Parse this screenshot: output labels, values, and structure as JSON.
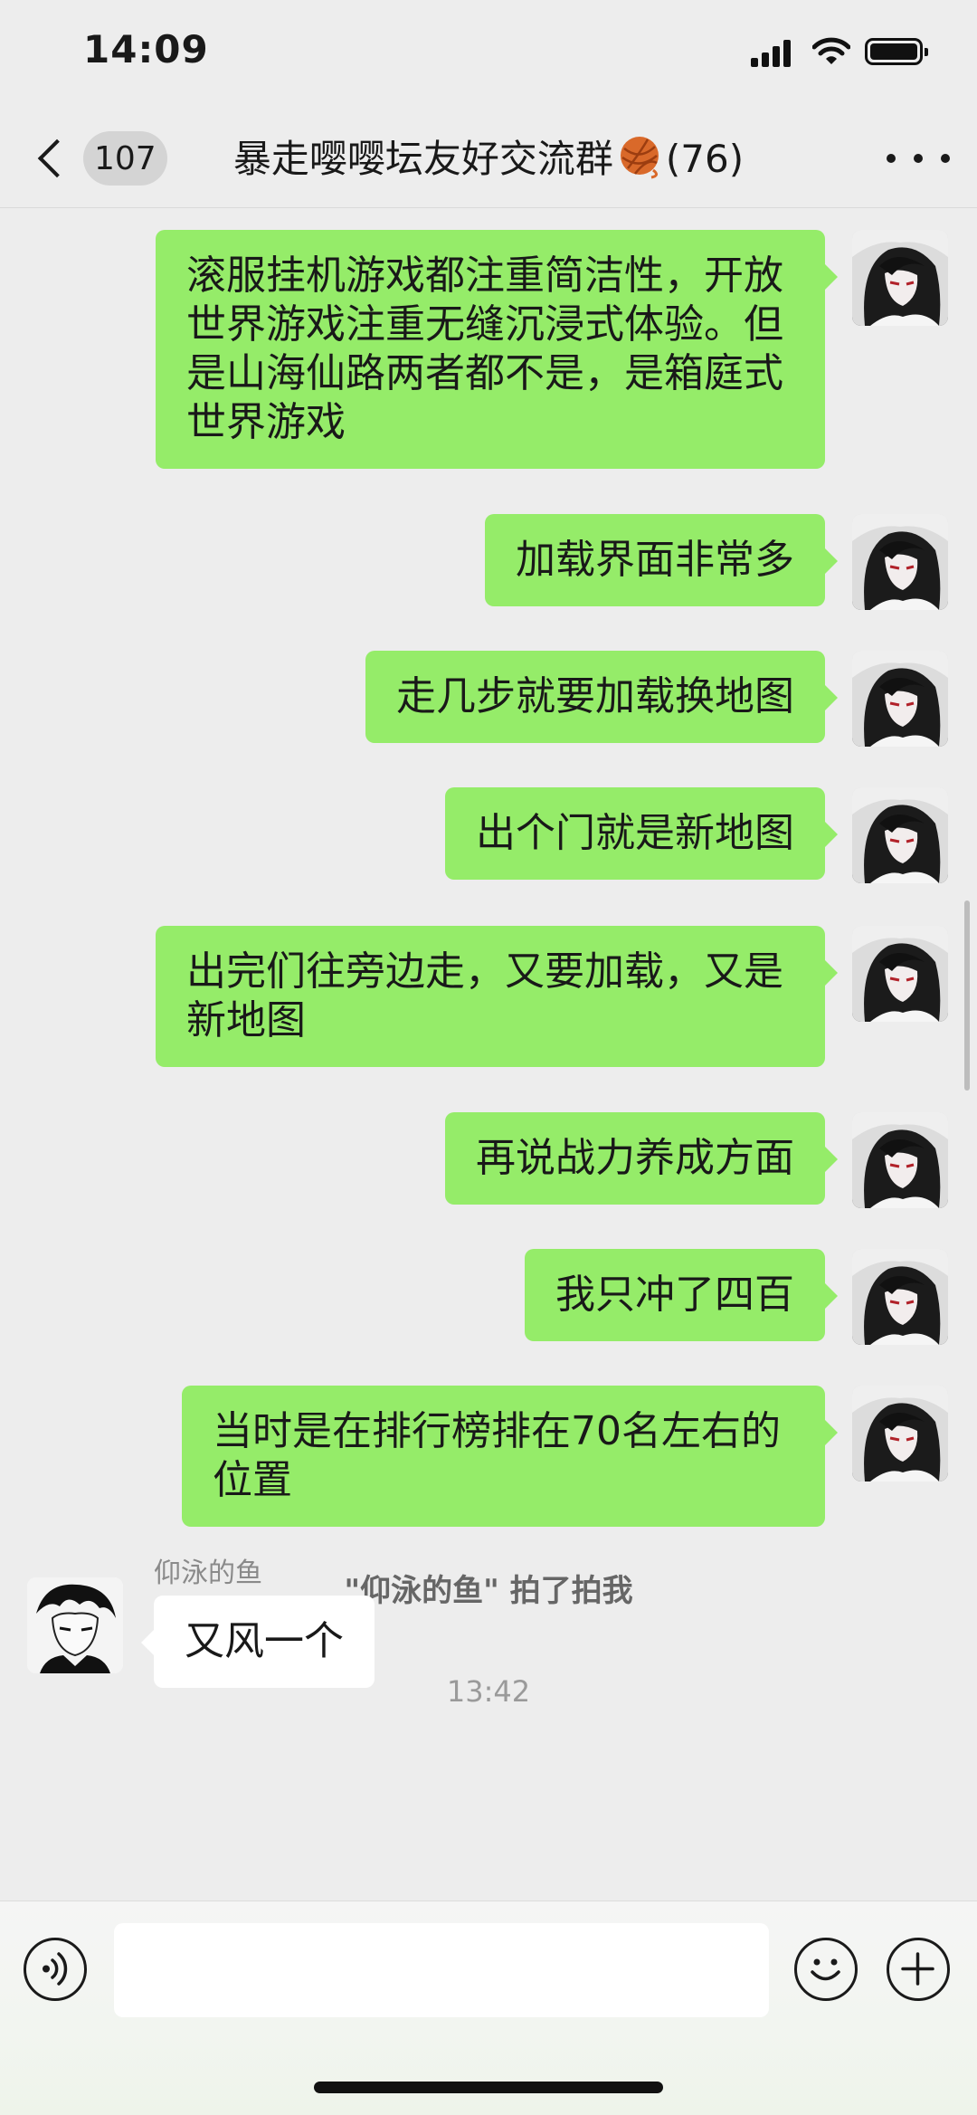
{
  "status_bar": {
    "time": "14:09"
  },
  "nav": {
    "unread_count": "107",
    "title_prefix": "暴走嘤嘤坛友好交流群",
    "title_suffix": "(76)"
  },
  "messages": [
    {
      "text": "滚服挂机游戏都注重简洁性，开放世界游戏注重无缝沉浸式体验。但是山海仙路两者都不是，是箱庭式世界游戏"
    },
    {
      "text": "加载界面非常多"
    },
    {
      "text": "走几步就要加载换地图"
    },
    {
      "text": "出个门就是新地图"
    },
    {
      "text": "出完们往旁边走，又要加载，又是新地图"
    },
    {
      "text": "再说战力养成方面"
    },
    {
      "text": "我只冲了四百"
    },
    {
      "text": "当时是在排行榜排在70名左右的位置"
    }
  ],
  "system": {
    "pat_name": "\"仰泳的鱼\"",
    "pat_action": " 拍了拍我",
    "timestamp": "13:42"
  },
  "incoming": {
    "sender": "仰泳的鱼",
    "text": "又风一个"
  },
  "colors": {
    "outgoing_bubble": "#95ec69",
    "incoming_bubble": "#ffffff",
    "background": "#ededed"
  },
  "icons": {
    "back": "chevron-left-icon",
    "more": "ellipsis-icon",
    "voice": "voice-icon",
    "emoji": "smiley-icon",
    "plus": "plus-icon",
    "title_emoji": "yarn-ball-icon"
  }
}
